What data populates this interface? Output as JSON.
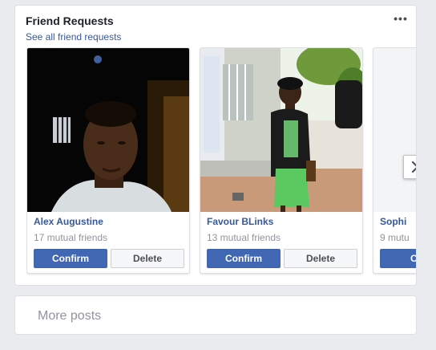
{
  "friend_requests": {
    "title": "Friend Requests",
    "see_all_label": "See all friend requests",
    "more_menu_glyph": "•••",
    "requests": [
      {
        "name": "Alex Augustine",
        "mutual": "17 mutual friends",
        "confirm_label": "Confirm",
        "delete_label": "Delete"
      },
      {
        "name": "Favour BLinks",
        "mutual": "13 mutual friends",
        "confirm_label": "Confirm",
        "delete_label": "Delete"
      },
      {
        "name": "Sophi",
        "mutual": "9 mutu",
        "confirm_label": "Co",
        "delete_label": ""
      }
    ],
    "next_icon": "chevron-right-icon"
  },
  "more_posts": {
    "label": "More posts"
  },
  "colors": {
    "page_bg": "#e9ebee",
    "link": "#385898",
    "name": "#365899",
    "confirm_bg": "#4267b2",
    "muted_text": "#90949c"
  }
}
